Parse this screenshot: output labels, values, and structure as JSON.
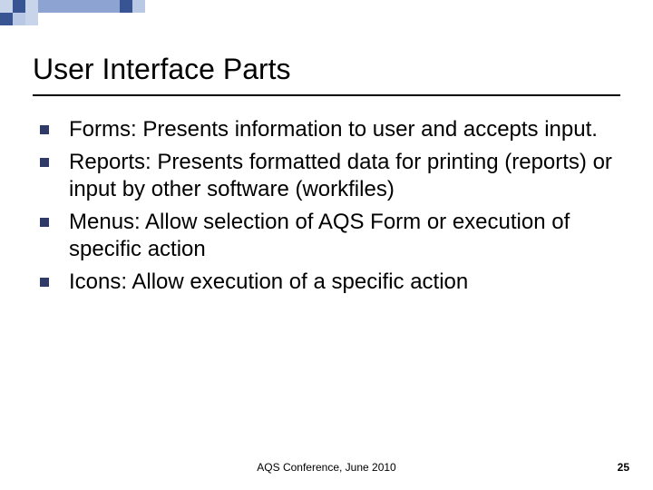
{
  "title": "User Interface Parts",
  "bullets": [
    "Forms:  Presents information to user and accepts input.",
    "Reports:  Presents formatted data for printing (reports) or input by other software (workfiles)",
    "Menus:  Allow selection of AQS Form or execution of specific action",
    "Icons: Allow execution of a specific action"
  ],
  "footer": "AQS Conference, June 2010",
  "page_number": "25",
  "decor_color": "#8da3d1"
}
